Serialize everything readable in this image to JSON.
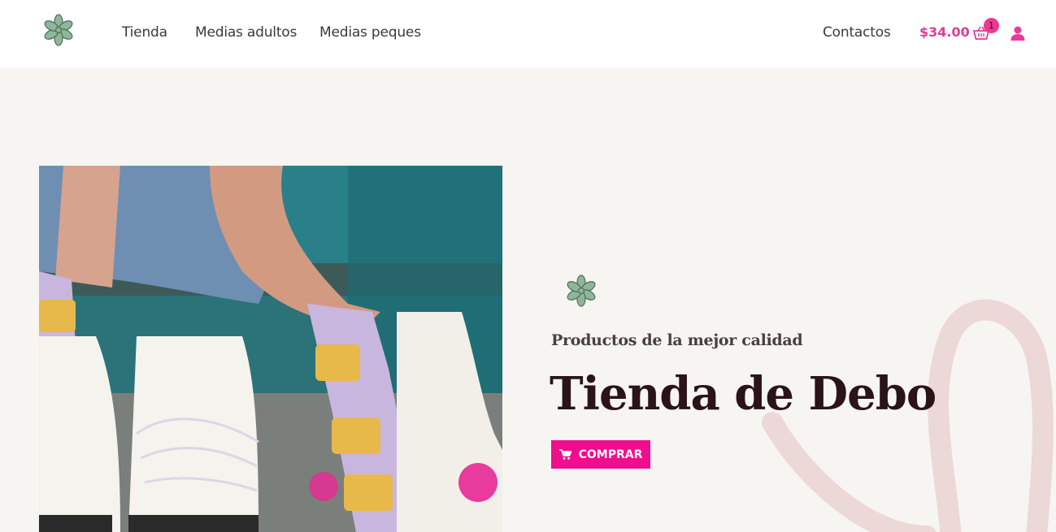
{
  "header": {
    "logo_icon": "flower-logo-icon",
    "nav": [
      {
        "label": "Tienda"
      },
      {
        "label": "Medias adultos"
      },
      {
        "label": "Medias peques"
      }
    ],
    "contact_label": "Contactos",
    "cart": {
      "total": "$34.00",
      "count": "1",
      "icon": "basket-icon"
    },
    "account_icon": "user-icon"
  },
  "hero": {
    "image_icon": "hero-photo-roller-skates-socks",
    "decoration_icon": "flower-icon",
    "subtitle": "Productos de la mejor calidad",
    "title": "Tienda de Debo",
    "button_label": "COMPRAR",
    "button_icon": "cart-icon"
  },
  "colors": {
    "accent": "#f00d8e",
    "price": "#d9409a",
    "flower": "#8fb59a",
    "background": "#f7f5f2",
    "swoosh": "#ecd8d6"
  }
}
